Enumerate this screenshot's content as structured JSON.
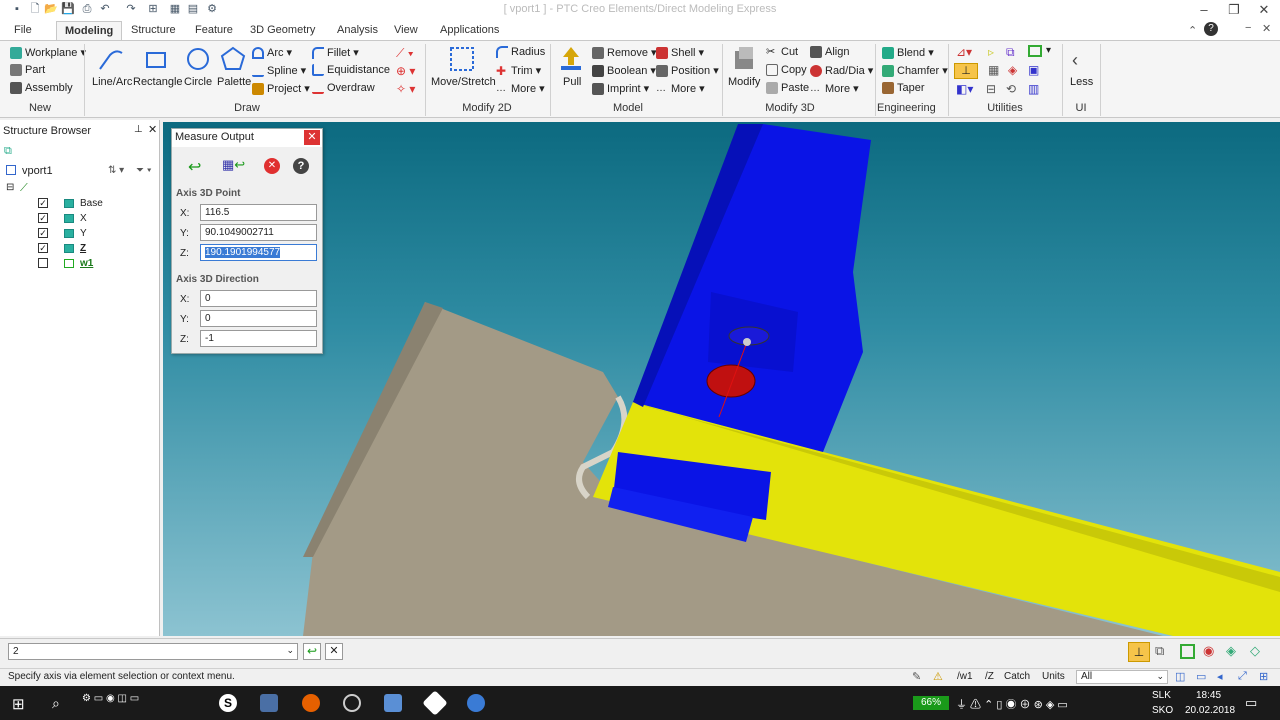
{
  "window": {
    "title": "[ vport1 ] - PTC Creo Elements/Direct Modeling Express"
  },
  "tabs": [
    "File",
    "Modeling",
    "Structure",
    "Feature",
    "3D Geometry",
    "Analysis",
    "View",
    "Applications"
  ],
  "ribbon": {
    "new": {
      "workplane": "Workplane",
      "part": "Part",
      "assembly": "Assembly",
      "group": "New"
    },
    "draw": {
      "line_arc": "Line/Arc",
      "rectangle": "Rectangle",
      "circle": "Circle",
      "palette": "Palette",
      "arc": "Arc",
      "spline": "Spline",
      "project": "Project",
      "fillet": "Fillet",
      "equidistance": "Equidistance",
      "overdraw": "Overdraw",
      "group": "Draw"
    },
    "modify2d": {
      "move_stretch": "Move/Stretch",
      "radius": "Radius",
      "trim": "Trim",
      "more": "More",
      "group": "Modify 2D"
    },
    "model": {
      "pull": "Pull",
      "remove": "Remove",
      "boolean": "Boolean",
      "imprint": "Imprint",
      "shell": "Shell",
      "position": "Position",
      "more": "More",
      "group": "Model"
    },
    "modify3d": {
      "modify": "Modify",
      "cut": "Cut",
      "copy": "Copy",
      "paste": "Paste",
      "align": "Align",
      "rad_dia": "Rad/Dia",
      "more": "More",
      "group": "Modify 3D"
    },
    "engineering": {
      "blend": "Blend",
      "chamfer": "Chamfer",
      "taper": "Taper",
      "group": "Engineering"
    },
    "utilities": {
      "group": "Utilities"
    },
    "ui": {
      "less": "Less",
      "group": "UI"
    }
  },
  "structure_browser": {
    "title": "Structure Browser",
    "root": "vport1",
    "items": [
      {
        "label": "Base",
        "checked": true
      },
      {
        "label": "X",
        "checked": true
      },
      {
        "label": "Y",
        "checked": true
      },
      {
        "label": "Z",
        "checked": true
      },
      {
        "label": "w1",
        "checked": false
      }
    ]
  },
  "measure_output": {
    "title": "Measure Output",
    "point_section": "Axis 3D Point",
    "direction_section": "Axis 3D Direction",
    "point": {
      "x_label": "X:",
      "x": "116.5",
      "y_label": "Y:",
      "y": "90.1049002711",
      "z_label": "Z:",
      "z": "190.1901994577"
    },
    "direction": {
      "x_label": "X:",
      "x": "0",
      "y_label": "Y:",
      "y": "0",
      "z_label": "Z:",
      "z": "-1"
    }
  },
  "command_line": {
    "value": "2"
  },
  "status": {
    "message": "Specify axis via element selection or context menu.",
    "workplane": "/w1",
    "axis": "/Z",
    "catch": "Catch",
    "units": "Units",
    "filter": "All"
  },
  "taskbar": {
    "battery": "66%",
    "lang": "SLK",
    "layout": "SKO",
    "time": "18:45",
    "date": "20.02.2018"
  },
  "colors": {
    "blue_part": "#0a14e6",
    "yellow_part": "#e3e30a",
    "base_part": "#a39a86",
    "viewport_top": "#0c6a80"
  }
}
